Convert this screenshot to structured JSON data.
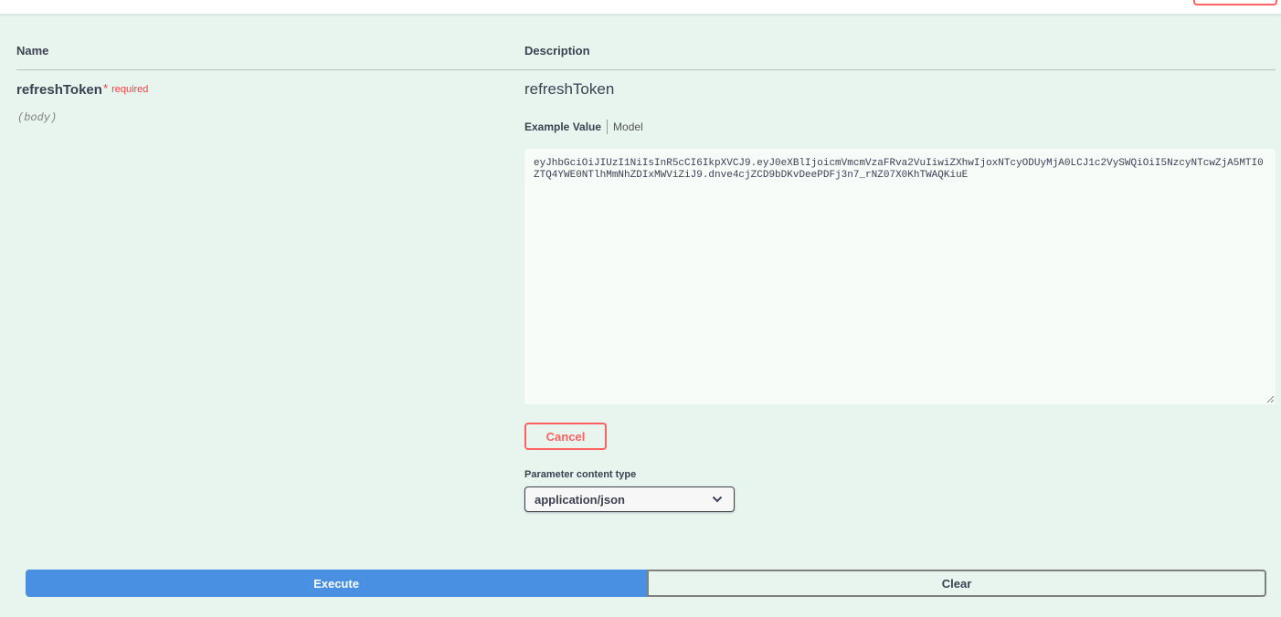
{
  "parameters": {
    "headers": {
      "name": "Name",
      "description": "Description"
    },
    "param": {
      "name": "refreshToken",
      "required_star": "*",
      "required_label": "required",
      "location": "(body)",
      "description": "refreshToken"
    }
  },
  "example": {
    "tab_example": "Example Value",
    "tab_model": "Model",
    "body_value": "eyJhbGciOiJIUzI1NiIsInR5cCI6IkpXVCJ9.eyJ0eXBlIjoicmVmcmVzaFRva2VuIiwiZXhwIjoxNTcyODUyMjA0LCJ1c2VySWQiOiI5NzcyNTcwZjA5MTI0ZTQ4YWE0NTlhMmNhZDIxMWViZiJ9.dnve4cjZCD9bDKvDeePDFj3n7_rNZ07X0KhTWAQKiuE"
  },
  "actions": {
    "cancel_label": "Cancel",
    "execute_label": "Execute",
    "clear_label": "Clear"
  },
  "content_type": {
    "label": "Parameter content type",
    "selected": "application/json"
  },
  "colors": {
    "background": "#e8f5ef",
    "execute": "#4990e2",
    "cancel": "#ff6060",
    "required": "#ff3b3b"
  },
  "icons": {
    "select_arrow": "chevron-down-icon"
  }
}
